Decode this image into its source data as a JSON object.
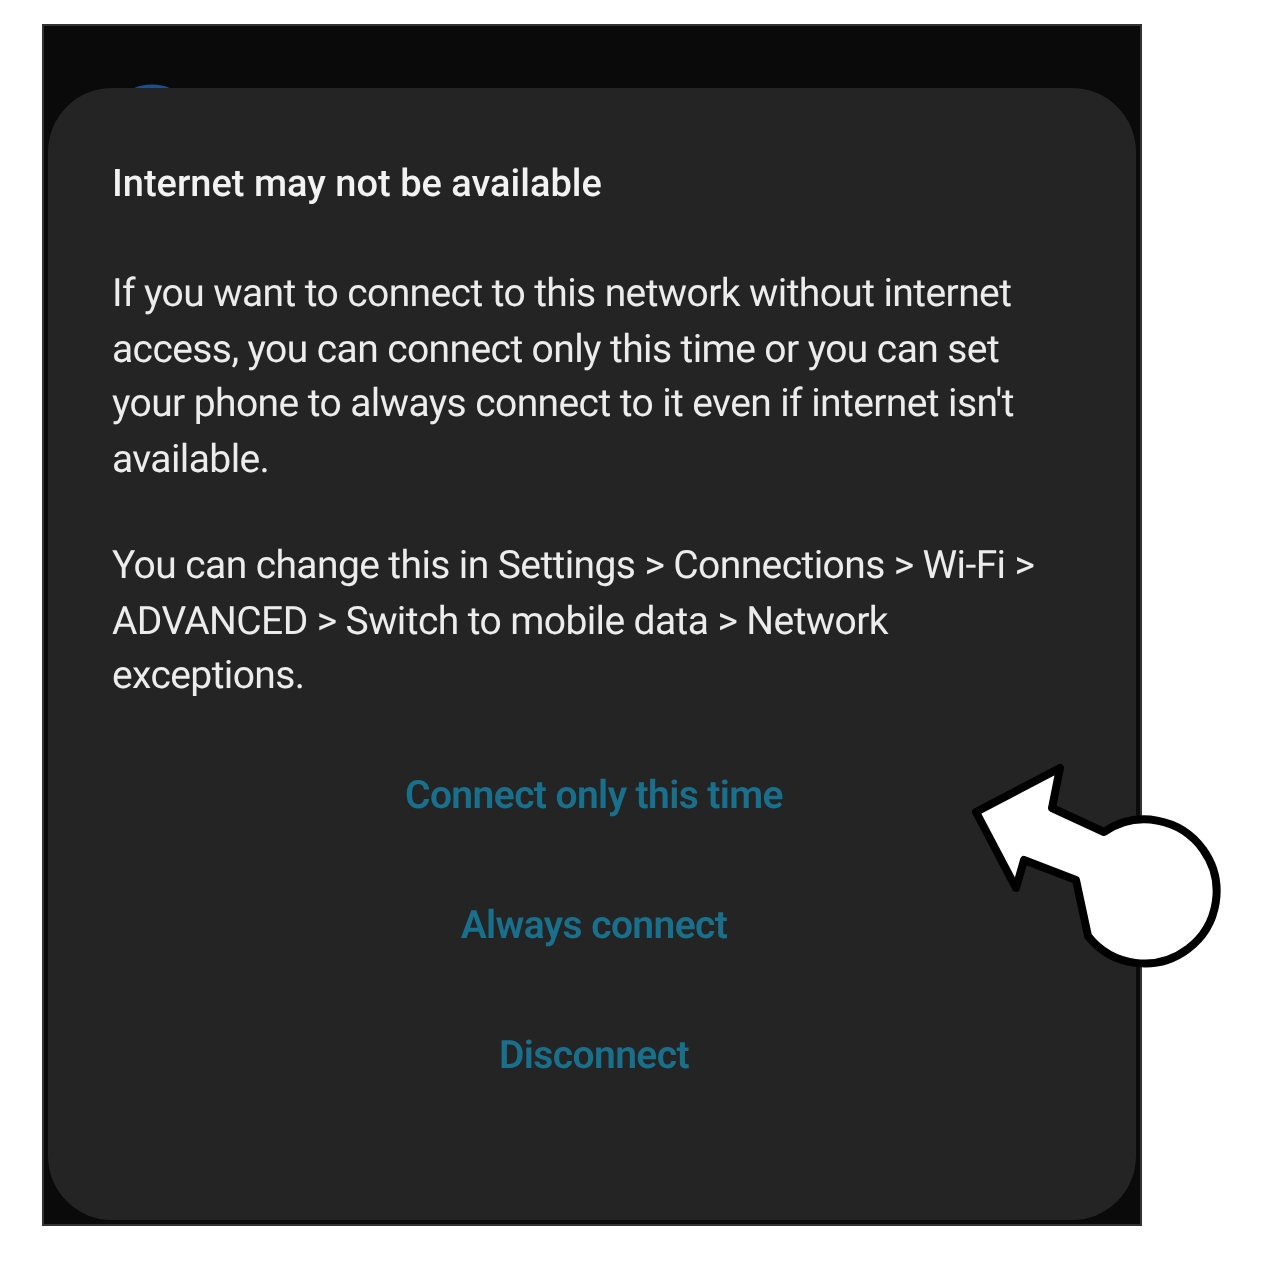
{
  "dialog": {
    "title": "Internet may not be available",
    "paragraphs": [
      "If you want to connect to this network without internet access, you can connect only this time or you can set your phone to always connect to it even if internet isn't available.",
      "You can change this in Settings > Connections > Wi-Fi > ADVANCED > Switch to mobile data > Network exceptions."
    ],
    "buttons": [
      "Connect only this time",
      "Always connect",
      "Disconnect"
    ]
  }
}
